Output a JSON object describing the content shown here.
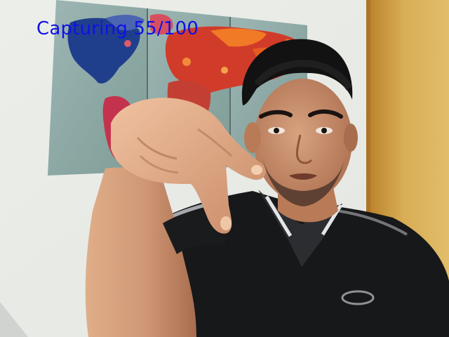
{
  "capture_overlay": {
    "label": "Capturing",
    "current": 55,
    "total": 100,
    "status_text": "Capturing 55/100",
    "color": "#1010e6"
  },
  "scene": {
    "wall_color": "#e7e9e4",
    "door_color": "#d7a94a",
    "shirt_color": "#161718",
    "skin_color": "#c98e6a",
    "hair_color": "#111111",
    "map_sea_color": "#8aa9a5"
  }
}
